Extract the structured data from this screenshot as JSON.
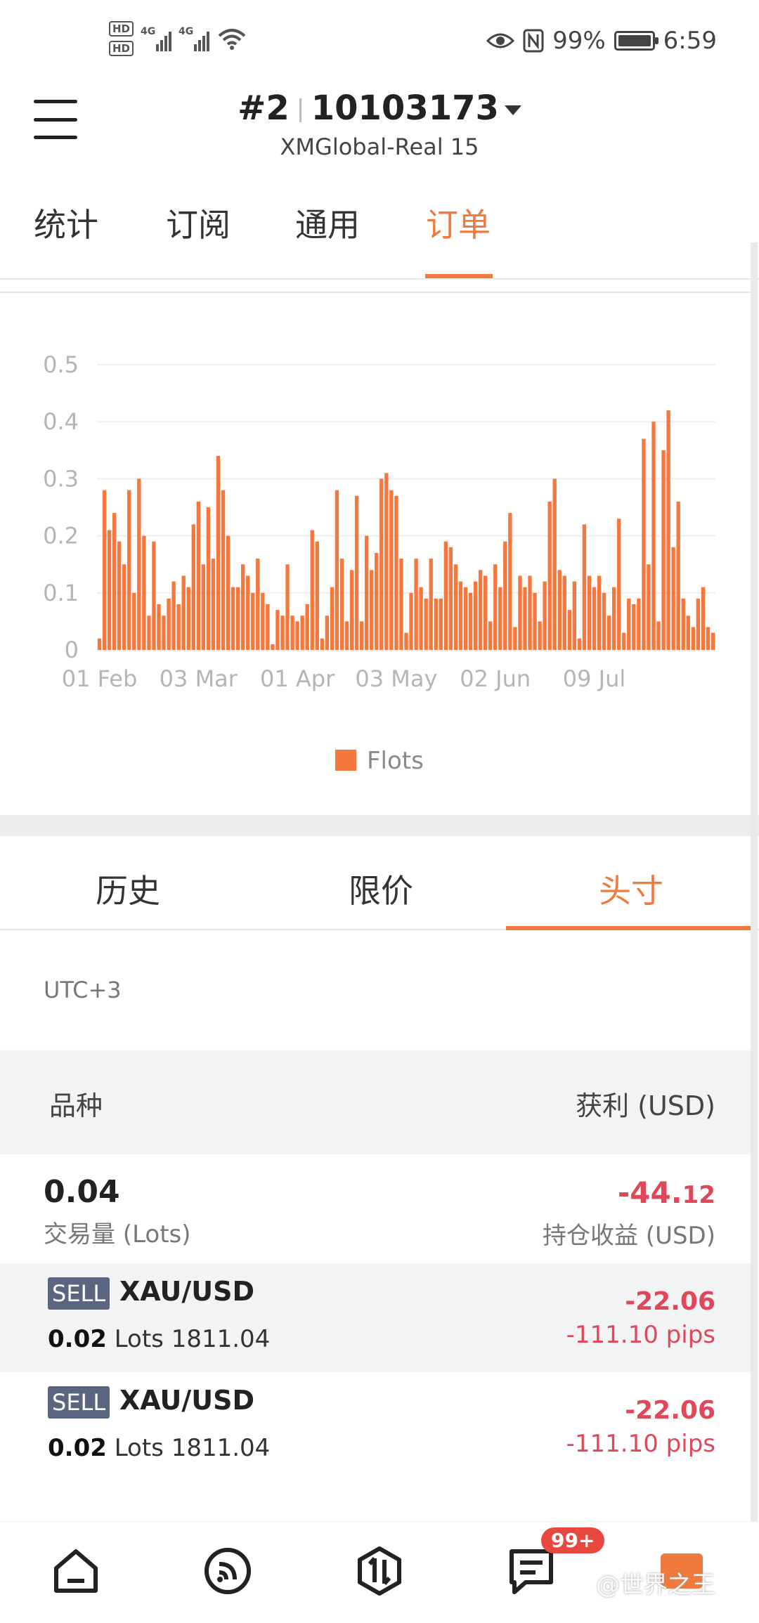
{
  "status_bar": {
    "hd1": "HD",
    "hd2": "HD",
    "net1": "4G",
    "net2": "4G",
    "battery_pct": "99%",
    "battery_level": 0.99,
    "time": "6:59"
  },
  "header": {
    "account_index": "#2",
    "account_number": "10103173",
    "server": "XMGlobal-Real 15"
  },
  "top_tabs": {
    "items": [
      "统计",
      "订阅",
      "通用",
      "订单"
    ],
    "active": "订单"
  },
  "chart_data": {
    "type": "bar",
    "title": "",
    "xlabel": "",
    "ylabel": "",
    "ylim": [
      0,
      0.5
    ],
    "yticks": [
      0,
      0.1,
      0.2,
      0.3,
      0.4,
      0.5
    ],
    "ytick_labels": [
      "0",
      "0.1",
      "0.2",
      "0.3",
      "0.4",
      "0.5"
    ],
    "xtick_labels": [
      "01 Feb",
      "03 Mar",
      "01 Apr",
      "03 May",
      "02 Jun",
      "09 Jul"
    ],
    "xtick_index": [
      0,
      20,
      40,
      60,
      80,
      100
    ],
    "legend": [
      "Flots"
    ],
    "legend_position": "bottom-center",
    "grid": true,
    "color": "#f5773d",
    "series": [
      {
        "name": "Flots",
        "values": [
          0.02,
          0.28,
          0.21,
          0.24,
          0.19,
          0.15,
          0.28,
          0.1,
          0.3,
          0.2,
          0.06,
          0.19,
          0.08,
          0.06,
          0.09,
          0.12,
          0.08,
          0.13,
          0.11,
          0.22,
          0.26,
          0.15,
          0.25,
          0.16,
          0.34,
          0.28,
          0.2,
          0.11,
          0.11,
          0.15,
          0.13,
          0.1,
          0.16,
          0.1,
          0.08,
          0.01,
          0.07,
          0.06,
          0.15,
          0.06,
          0.05,
          0.06,
          0.08,
          0.21,
          0.19,
          0.02,
          0.06,
          0.11,
          0.28,
          0.16,
          0.05,
          0.14,
          0.27,
          0.05,
          0.2,
          0.14,
          0.17,
          0.3,
          0.31,
          0.28,
          0.27,
          0.16,
          0.03,
          0.1,
          0.16,
          0.11,
          0.09,
          0.16,
          0.09,
          0.09,
          0.19,
          0.18,
          0.15,
          0.12,
          0.11,
          0.1,
          0.12,
          0.14,
          0.13,
          0.05,
          0.15,
          0.11,
          0.19,
          0.24,
          0.04,
          0.13,
          0.11,
          0.13,
          0.1,
          0.05,
          0.12,
          0.26,
          0.3,
          0.14,
          0.13,
          0.07,
          0.12,
          0.02,
          0.22,
          0.13,
          0.11,
          0.13,
          0.1,
          0.06,
          0.11,
          0.23,
          0.03,
          0.09,
          0.08,
          0.09,
          0.37,
          0.15,
          0.4,
          0.05,
          0.35,
          0.42,
          0.18,
          0.26,
          0.09,
          0.06,
          0.04,
          0.09,
          0.11,
          0.04,
          0.03
        ]
      }
    ]
  },
  "sub_tabs": {
    "items": [
      "历史",
      "限价",
      "头寸"
    ],
    "active": "头寸"
  },
  "timezone": "UTC+3",
  "table": {
    "col_symbol": "品种",
    "col_profit": "获利 (USD)"
  },
  "summary": {
    "volume": "0.04",
    "volume_label": "交易量 (Lots)",
    "pl_main": "-44.",
    "pl_dec": "12",
    "pl_label": "持仓收益 (USD)"
  },
  "positions": [
    {
      "side": "SELL",
      "symbol": "XAU/USD",
      "lots": "0.02",
      "lots_unit": "Lots",
      "price": "1811.04",
      "pnl": "-22.06",
      "pips": "-111.10 pips"
    },
    {
      "side": "SELL",
      "symbol": "XAU/USD",
      "lots": "0.02",
      "lots_unit": "Lots",
      "price": "1811.04",
      "pnl": "-22.06",
      "pips": "-111.10 pips"
    }
  ],
  "bottom_nav": {
    "items": [
      "home-icon",
      "feed-icon",
      "trade-icon",
      "messages-icon",
      "brand-icon"
    ],
    "badge": "99+",
    "watermark": "@世界之王"
  }
}
